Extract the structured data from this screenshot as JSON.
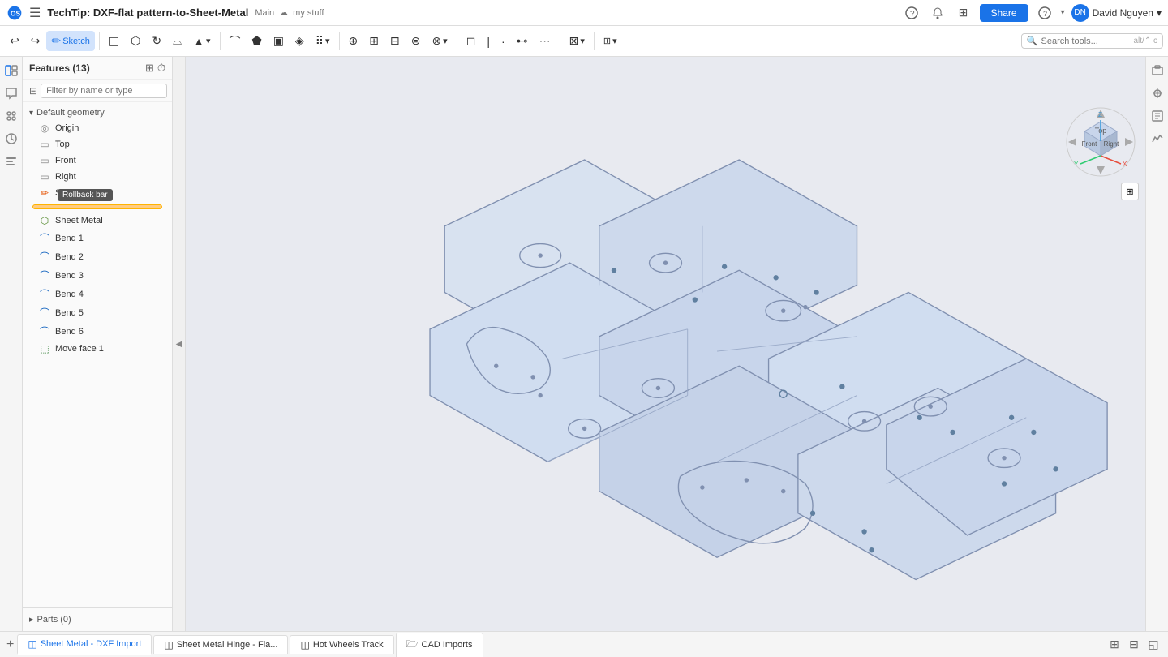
{
  "topbar": {
    "logo_text": "onshape",
    "hamburger_icon": "☰",
    "doc_title": "TechTip: DXF-flat pattern-to-Sheet-Metal",
    "branch": "Main",
    "cloud_icon": "☁",
    "my_stuff": "my stuff",
    "share_label": "Share",
    "help_icon": "?",
    "user_name": "David Nguyen",
    "user_chevron": "▾",
    "notifications_icon": "🔔",
    "apps_icon": "⊞"
  },
  "toolbar": {
    "sketch_label": "Sketch",
    "undo_icon": "↩",
    "redo_icon": "↪",
    "search_placeholder": "Search tools...",
    "search_shortcut": "alt/⌃ c"
  },
  "feature_panel": {
    "title": "Features (13)",
    "filter_placeholder": "Filter by name or type",
    "expand_icon": "⊞",
    "timer_icon": "⏱",
    "default_geometry_label": "Default geometry",
    "items": [
      {
        "id": "origin",
        "label": "Origin",
        "icon": "◎",
        "type": "origin"
      },
      {
        "id": "top",
        "label": "Top",
        "icon": "▭",
        "type": "plane"
      },
      {
        "id": "front",
        "label": "Front",
        "icon": "▭",
        "type": "plane"
      },
      {
        "id": "right",
        "label": "Right",
        "icon": "▭",
        "type": "plane"
      }
    ],
    "sketch_items": [
      {
        "id": "sketch1",
        "label": "Sketch 1",
        "icon": "✏",
        "type": "sketch"
      }
    ],
    "sheet_items": [
      {
        "id": "sheetmetal",
        "label": "Sheet Metal",
        "icon": "⬡",
        "type": "sheet"
      }
    ],
    "bend_items": [
      {
        "id": "bend1",
        "label": "Bend 1",
        "icon": "⌒",
        "type": "bend"
      },
      {
        "id": "bend2",
        "label": "Bend 2",
        "icon": "⌒",
        "type": "bend"
      },
      {
        "id": "bend3",
        "label": "Bend 3",
        "icon": "⌒",
        "type": "bend"
      },
      {
        "id": "bend4",
        "label": "Bend 4",
        "icon": "⌒",
        "type": "bend"
      },
      {
        "id": "bend5",
        "label": "Bend 5",
        "icon": "⌒",
        "type": "bend"
      },
      {
        "id": "bend6",
        "label": "Bend 6",
        "icon": "⌒",
        "type": "bend"
      }
    ],
    "move_items": [
      {
        "id": "moveface1",
        "label": "Move face 1",
        "icon": "⬚",
        "type": "move"
      }
    ],
    "rollback_tooltip": "Rollback bar",
    "parts_label": "Parts (0)",
    "parts_count": "0"
  },
  "view_cube": {
    "top_label": "Top",
    "front_label": "Front",
    "right_label": "Right",
    "x_color": "#e74c3c",
    "y_color": "#2ecc71",
    "z_color": "#3498db"
  },
  "bottom_tabs": {
    "add_icon": "+",
    "tabs": [
      {
        "id": "tab1",
        "label": "Sheet Metal - DXF Import",
        "icon": "◫",
        "active": true
      },
      {
        "id": "tab2",
        "label": "Sheet Metal Hinge - Fla...",
        "icon": "◫",
        "active": false
      },
      {
        "id": "tab3",
        "label": "Hot Wheels Track",
        "icon": "◫",
        "active": false
      },
      {
        "id": "tab4",
        "label": "CAD Imports",
        "icon": "🗁",
        "active": false
      }
    ],
    "action_icons": [
      "⊞",
      "⊟",
      "◱"
    ]
  }
}
